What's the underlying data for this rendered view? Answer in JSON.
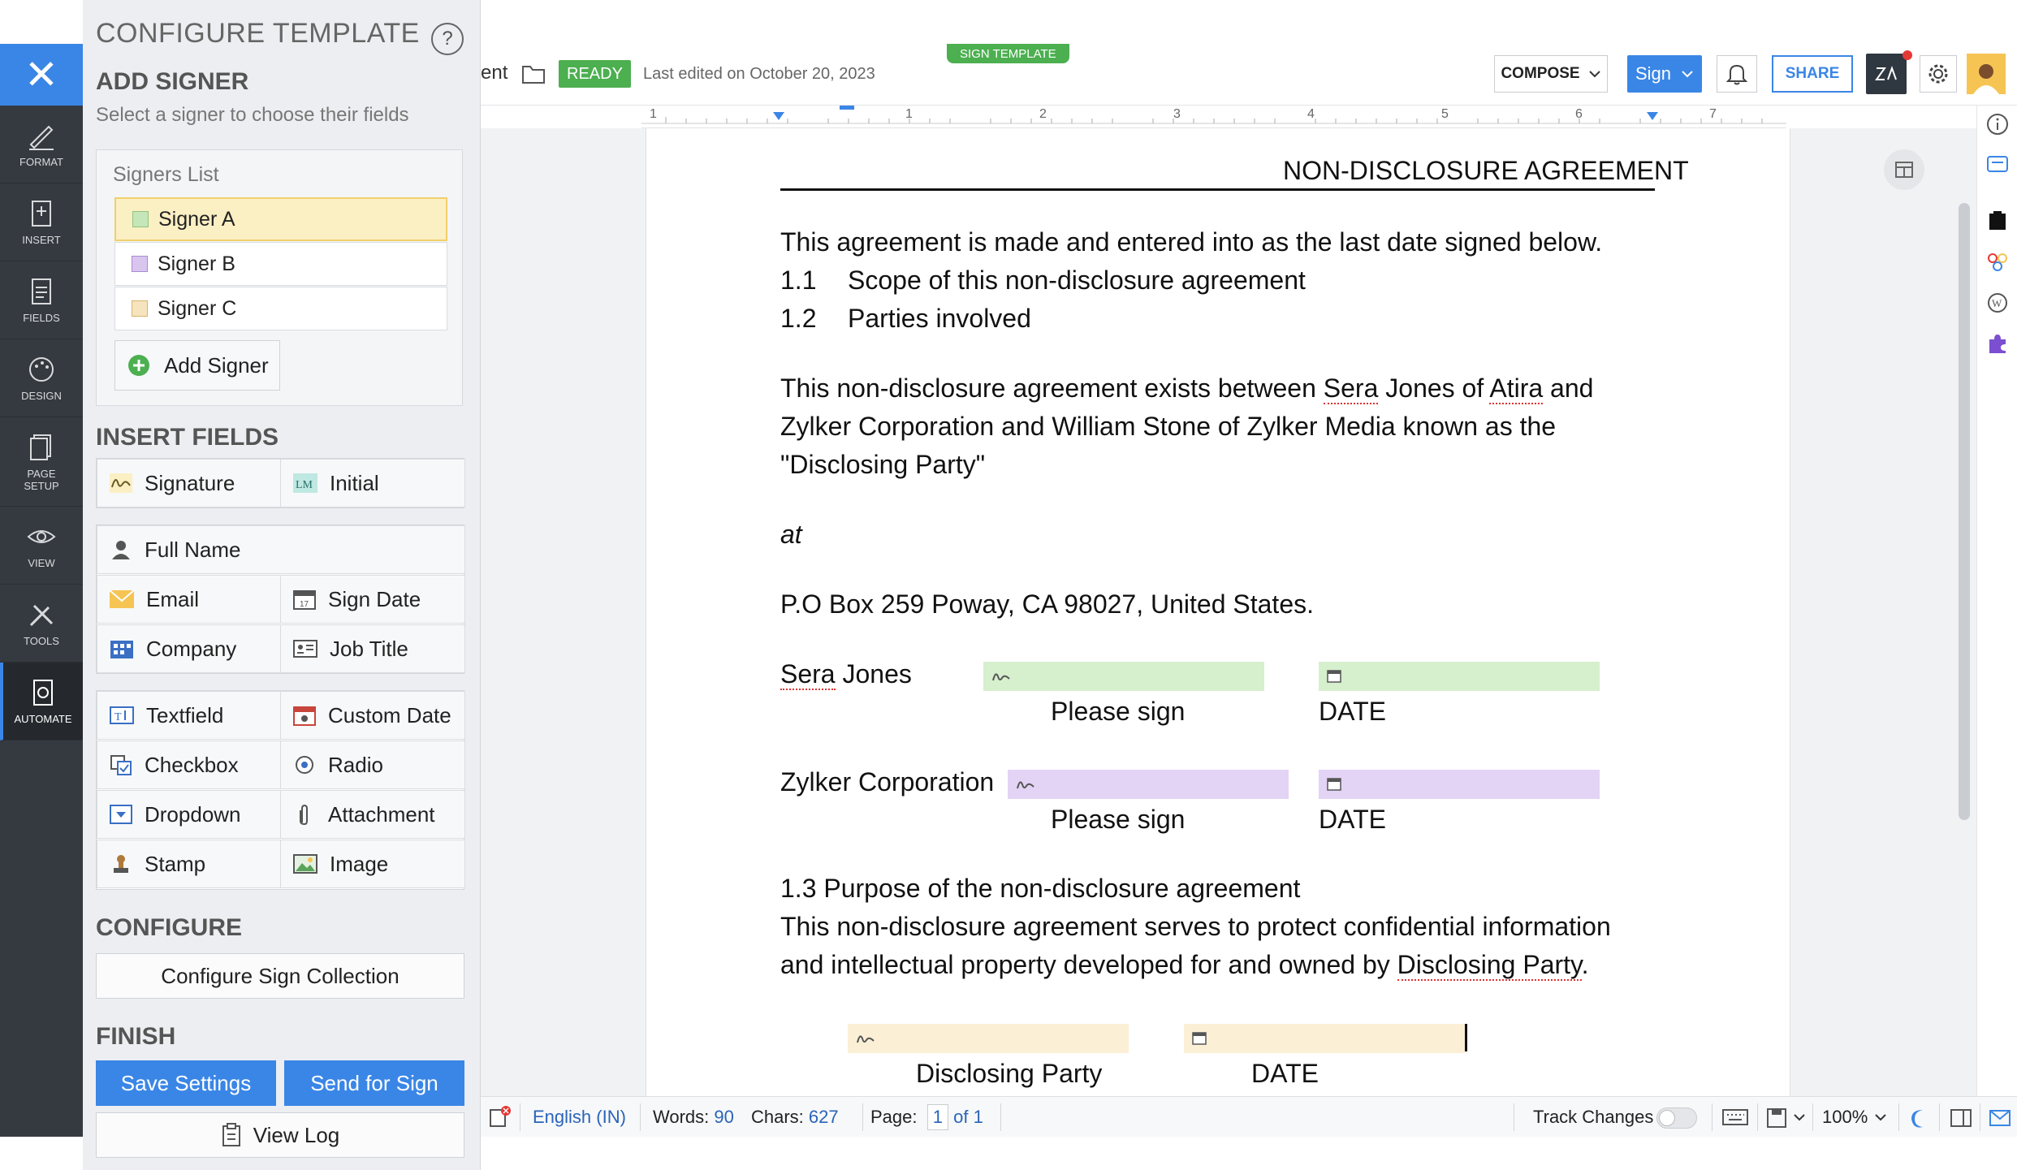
{
  "rail": {
    "items": [
      {
        "label": "FORMAT"
      },
      {
        "label": "INSERT"
      },
      {
        "label": "FIELDS"
      },
      {
        "label": "DESIGN"
      },
      {
        "label": "PAGE\nSETUP"
      },
      {
        "label": "VIEW"
      },
      {
        "label": "TOOLS"
      },
      {
        "label": "AUTOMATE"
      }
    ]
  },
  "panel": {
    "title": "CONFIGURE TEMPLATE",
    "help": "?",
    "add_signer_heading": "ADD SIGNER",
    "add_signer_sub": "Select a signer to choose their fields",
    "signers_list_label": "Signers List",
    "signers": [
      {
        "name": "Signer A",
        "color": "#c5e6b8"
      },
      {
        "name": "Signer B",
        "color": "#d9c6ef"
      },
      {
        "name": "Signer C",
        "color": "#f6e4bf"
      }
    ],
    "add_signer_button": "Add Signer",
    "insert_fields_heading": "INSERT FIELDS",
    "fields": {
      "signature": "Signature",
      "initial": "Initial",
      "full_name": "Full Name",
      "email": "Email",
      "sign_date": "Sign Date",
      "company": "Company",
      "job_title": "Job Title",
      "textfield": "Textfield",
      "custom_date": "Custom Date",
      "checkbox": "Checkbox",
      "radio": "Radio",
      "dropdown": "Dropdown",
      "attachment": "Attachment",
      "stamp": "Stamp",
      "image": "Image"
    },
    "configure_heading": "CONFIGURE",
    "configure_button": "Configure Sign Collection",
    "finish_heading": "FINISH",
    "save_button": "Save Settings",
    "send_button": "Send for Sign",
    "view_log_button": "View Log"
  },
  "topbar": {
    "doc_name_fragment": "ent",
    "status_badge": "READY",
    "last_edited": "Last edited on October 20, 2023",
    "sign_template_tag": "SIGN TEMPLATE",
    "compose_button": "COMPOSE",
    "sign_button": "Sign",
    "share_button": "SHARE"
  },
  "ruler": {
    "ticks": [
      "1",
      "1",
      "2",
      "3",
      "4",
      "5",
      "6",
      "7"
    ]
  },
  "document": {
    "heading": "NON-DISCLOSURE AGREEMENT",
    "intro": "This agreement is made and entered into as the last date signed below.",
    "item1_num": "1.1",
    "item1_text": "Scope of this non-disclosure agreement",
    "item2_num": "1.2",
    "item2_text": "Parties involved",
    "para1_a": "This non-disclosure agreement exists between ",
    "para1_sera": "Sera",
    "para1_b": " Jones of ",
    "para1_atira": "Atira",
    "para1_c": " and",
    "para1_line2": "Zylker Corporation and William Stone of Zylker Media known as the",
    "para1_line3": "\"Disclosing Party\"",
    "at": "at",
    "address": "P.O Box 259 Poway, CA 98027, United States.",
    "party1_first": "Sera",
    "party1_last": " Jones",
    "party2": "Zylker Corporation",
    "please_sign": "Please sign",
    "date_label": "DATE",
    "section3_title": "1.3 Purpose of the non-disclosure agreement",
    "section3_line1": "This non-disclosure agreement serves to protect confidential information",
    "section3_line2_a": "and intellectual property developed for and owned by ",
    "section3_line2_b": "Disclosing Party",
    "section3_line2_c": ".",
    "party3": "Disclosing Party"
  },
  "status": {
    "language": "English (IN)",
    "words_label": "Words:",
    "words": "90",
    "chars_label": "Chars:",
    "chars": "627",
    "page_label": "Page:",
    "page_current": "1",
    "page_of": "of 1",
    "track_changes": "Track Changes",
    "zoom": "100%"
  },
  "colors": {
    "accent": "#3a86e6",
    "ready": "#4caf50",
    "signer_a": "#d6efcd",
    "signer_b": "#e3d3f5",
    "signer_c": "#fbefd6"
  }
}
